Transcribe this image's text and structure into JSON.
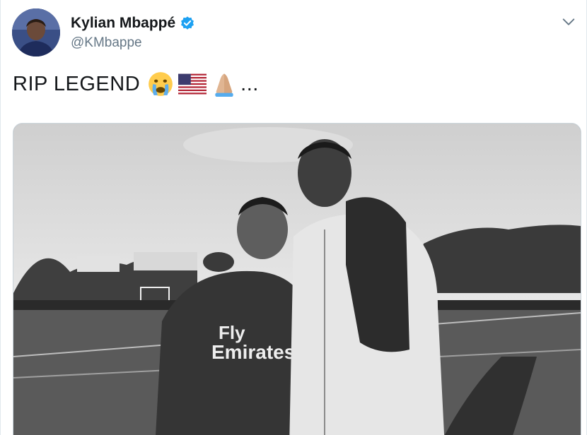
{
  "tweet": {
    "author": {
      "display_name": "Kylian Mbappé",
      "handle": "@KMbappe",
      "verified": true,
      "avatar_icon": "profile-photo"
    },
    "text": "RIP LEGEND",
    "emojis": [
      "crying-face",
      "us-flag",
      "folded-hands"
    ],
    "ellipsis": "...",
    "menu_icon": "chevron-down-icon",
    "media": {
      "type": "photo",
      "jersey_text_line1": "Fly",
      "jersey_text_line2": "Emirates"
    }
  },
  "colors": {
    "verified_blue": "#1da1f2",
    "text_primary": "#14171a",
    "text_secondary": "#657786"
  }
}
